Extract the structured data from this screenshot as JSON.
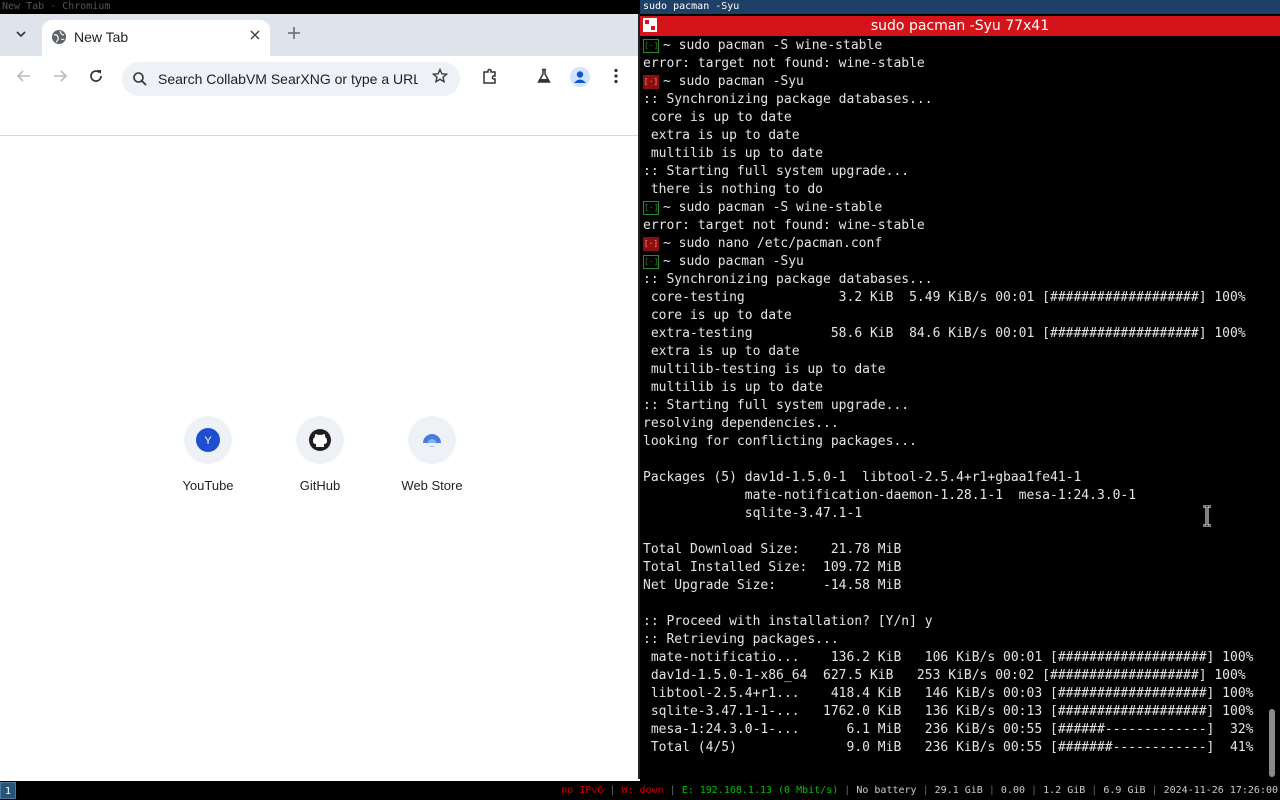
{
  "left_window": {
    "wm_title": "New Tab - Chromium"
  },
  "browser": {
    "tab": {
      "title": "New Tab"
    },
    "omnibox": {
      "placeholder": "Search CollabVM SearXNG or type a URL"
    },
    "shortcuts": [
      {
        "label": "YouTube",
        "icon_letter": "Y"
      },
      {
        "label": "GitHub"
      },
      {
        "label": "Web Store"
      }
    ]
  },
  "right_window": {
    "wm_title": "sudo pacman -Syu",
    "terminal_title": "sudo pacman -Syu 77x41"
  },
  "terminal": {
    "prompt_glyph": "[·]",
    "lines": [
      {
        "prompt": "ok",
        "text": "~ sudo pacman -S wine-stable"
      },
      {
        "text": "error: target not found: wine-stable"
      },
      {
        "prompt": "err",
        "text": "~ sudo pacman -Syu"
      },
      {
        "text": ":: Synchronizing package databases..."
      },
      {
        "text": " core is up to date"
      },
      {
        "text": " extra is up to date"
      },
      {
        "text": " multilib is up to date"
      },
      {
        "text": ":: Starting full system upgrade..."
      },
      {
        "text": " there is nothing to do"
      },
      {
        "prompt": "ok",
        "text": "~ sudo pacman -S wine-stable"
      },
      {
        "text": "error: target not found: wine-stable"
      },
      {
        "prompt": "err",
        "text": "~ sudo nano /etc/pacman.conf"
      },
      {
        "prompt": "ok",
        "text": "~ sudo pacman -Syu"
      },
      {
        "text": ":: Synchronizing package databases..."
      },
      {
        "text": " core-testing            3.2 KiB  5.49 KiB/s 00:01 [###################] 100%"
      },
      {
        "text": " core is up to date"
      },
      {
        "text": " extra-testing          58.6 KiB  84.6 KiB/s 00:01 [###################] 100%"
      },
      {
        "text": " extra is up to date"
      },
      {
        "text": " multilib-testing is up to date"
      },
      {
        "text": " multilib is up to date"
      },
      {
        "text": ":: Starting full system upgrade..."
      },
      {
        "text": "resolving dependencies..."
      },
      {
        "text": "looking for conflicting packages..."
      },
      {
        "text": ""
      },
      {
        "text": "Packages (5) dav1d-1.5.0-1  libtool-2.5.4+r1+gbaa1fe41-1"
      },
      {
        "text": "             mate-notification-daemon-1.28.1-1  mesa-1:24.3.0-1"
      },
      {
        "text": "             sqlite-3.47.1-1"
      },
      {
        "text": ""
      },
      {
        "text": "Total Download Size:    21.78 MiB"
      },
      {
        "text": "Total Installed Size:  109.72 MiB"
      },
      {
        "text": "Net Upgrade Size:      -14.58 MiB"
      },
      {
        "text": ""
      },
      {
        "text": ":: Proceed with installation? [Y/n] y"
      },
      {
        "text": ":: Retrieving packages..."
      },
      {
        "text": " mate-notificatio...    136.2 KiB   106 KiB/s 00:01 [###################] 100%"
      },
      {
        "text": " dav1d-1.5.0-1-x86_64  627.5 KiB   253 KiB/s 00:02 [###################] 100%"
      },
      {
        "text": " libtool-2.5.4+r1...    418.4 KiB   146 KiB/s 00:03 [###################] 100%"
      },
      {
        "text": " sqlite-3.47.1-1-...   1762.0 KiB   136 KiB/s 00:13 [###################] 100%"
      },
      {
        "text": " mesa-1:24.3.0-1-...      6.1 MiB   236 KiB/s 00:55 [######-------------]  32%"
      },
      {
        "text": " Total (4/5)              9.0 MiB   236 KiB/s 00:55 [#######------------]  41%"
      }
    ]
  },
  "statusbar": {
    "workspace": "1",
    "ipv6": "no IPv6",
    "wifi": "W: down",
    "ethernet": "E: 192.168.1.13 (0 Mbit/s)",
    "battery": "No battery",
    "disk": "29.1 GiB",
    "load": "0.00",
    "memory": "1.2 GiB",
    "swap": "6.9 GiB",
    "datetime": "2024-11-26 17:26:00"
  }
}
